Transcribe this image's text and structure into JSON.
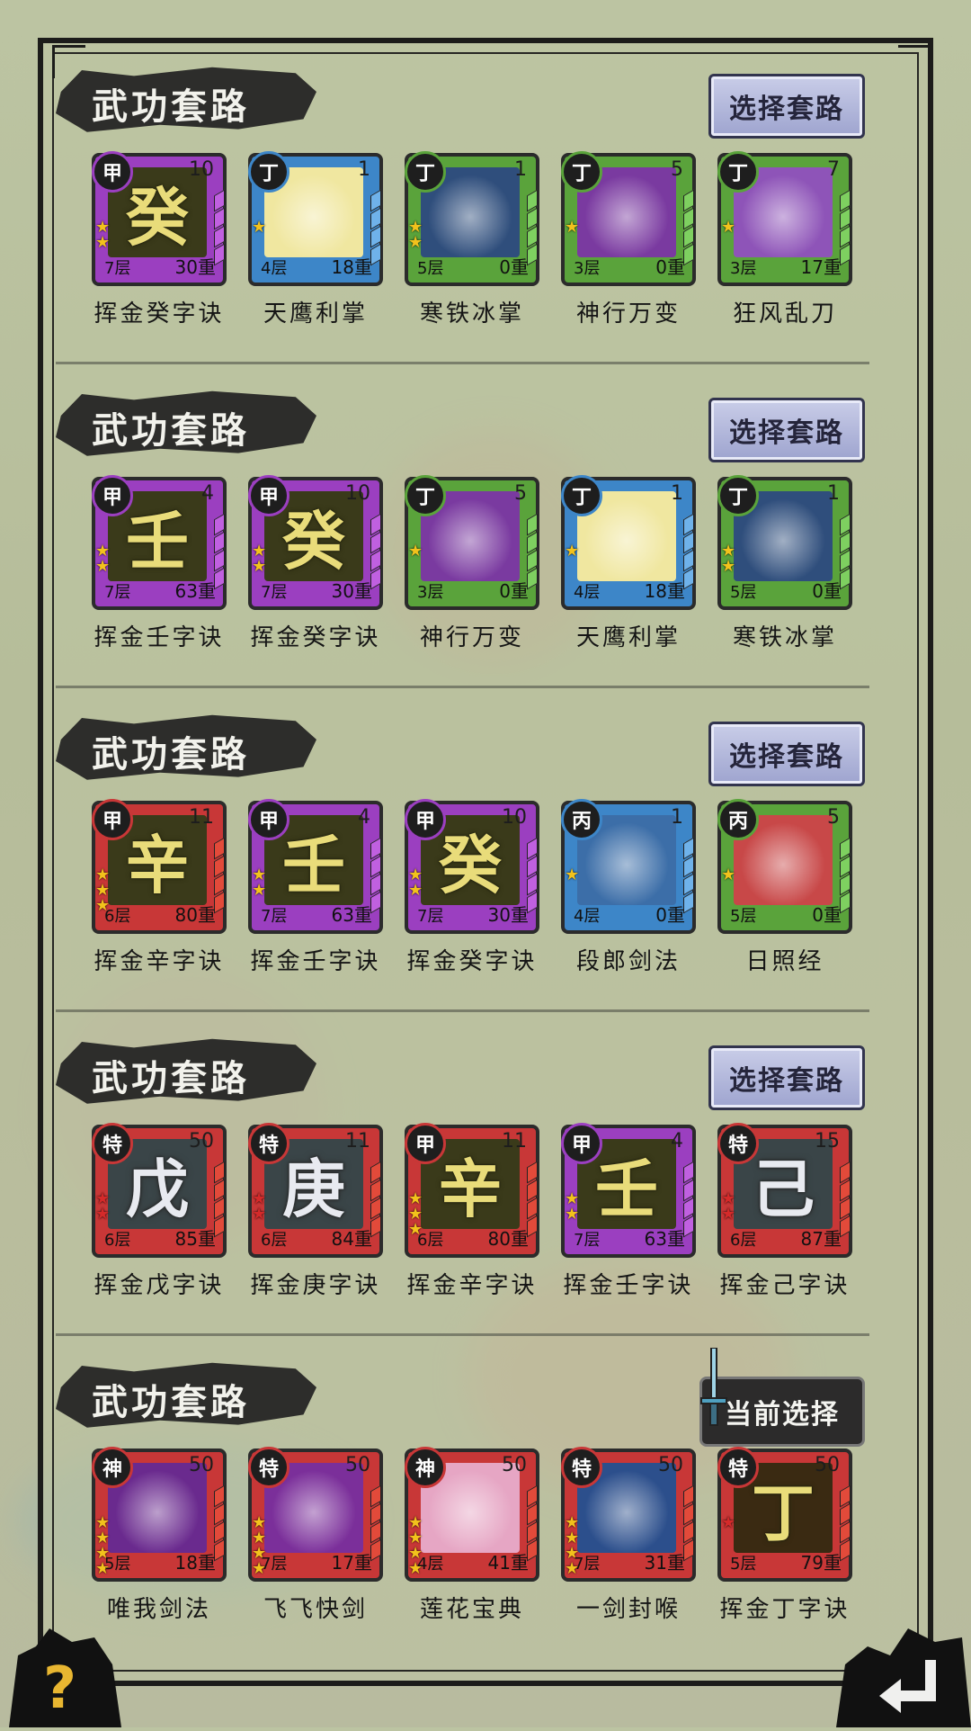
{
  "sections": [
    {
      "title": "武功套路",
      "button": "选择套路",
      "cards": [
        {
          "grade": "甲",
          "level": "10",
          "layer": "7层",
          "weight": "30重",
          "name": "挥金癸字诀",
          "glyph": "癸",
          "frame": "#9b3fc0",
          "art": "#3a3a1a",
          "stars": 2,
          "star_color": "gold"
        },
        {
          "grade": "丁",
          "level": "1",
          "layer": "4层",
          "weight": "18重",
          "name": "天鹰利掌",
          "glyph": "",
          "frame": "#3d86c8",
          "art": "#f0e7a0",
          "stars": 1,
          "star_color": "gold"
        },
        {
          "grade": "丁",
          "level": "1",
          "layer": "5层",
          "weight": "0重",
          "name": "寒铁冰掌",
          "glyph": "",
          "frame": "#5aa33b",
          "art": "#2f4e7c",
          "stars": 2,
          "star_color": "gold"
        },
        {
          "grade": "丁",
          "level": "5",
          "layer": "3层",
          "weight": "0重",
          "name": "神行万变",
          "glyph": "",
          "frame": "#5aa33b",
          "art": "#7a3aa0",
          "stars": 1,
          "star_color": "gold"
        },
        {
          "grade": "丁",
          "level": "7",
          "layer": "3层",
          "weight": "17重",
          "name": "狂风乱刀",
          "glyph": "",
          "frame": "#5aa33b",
          "art": "#8e54b8",
          "stars": 1,
          "star_color": "gold"
        }
      ]
    },
    {
      "title": "武功套路",
      "button": "选择套路",
      "cards": [
        {
          "grade": "甲",
          "level": "4",
          "layer": "7层",
          "weight": "63重",
          "name": "挥金壬字诀",
          "glyph": "壬",
          "frame": "#9b3fc0",
          "art": "#3a3a1a",
          "stars": 2,
          "star_color": "gold"
        },
        {
          "grade": "甲",
          "level": "10",
          "layer": "7层",
          "weight": "30重",
          "name": "挥金癸字诀",
          "glyph": "癸",
          "frame": "#9b3fc0",
          "art": "#3a3a1a",
          "stars": 2,
          "star_color": "gold"
        },
        {
          "grade": "丁",
          "level": "5",
          "layer": "3层",
          "weight": "0重",
          "name": "神行万变",
          "glyph": "",
          "frame": "#5aa33b",
          "art": "#7a3aa0",
          "stars": 1,
          "star_color": "gold"
        },
        {
          "grade": "丁",
          "level": "1",
          "layer": "4层",
          "weight": "18重",
          "name": "天鹰利掌",
          "glyph": "",
          "frame": "#3d86c8",
          "art": "#f0e7a0",
          "stars": 1,
          "star_color": "gold"
        },
        {
          "grade": "丁",
          "level": "1",
          "layer": "5层",
          "weight": "0重",
          "name": "寒铁冰掌",
          "glyph": "",
          "frame": "#5aa33b",
          "art": "#2f4e7c",
          "stars": 2,
          "star_color": "gold"
        }
      ]
    },
    {
      "title": "武功套路",
      "button": "选择套路",
      "cards": [
        {
          "grade": "甲",
          "level": "11",
          "layer": "6层",
          "weight": "80重",
          "name": "挥金辛字诀",
          "glyph": "辛",
          "frame": "#c83737",
          "art": "#3a3a1a",
          "stars": 3,
          "star_color": "gold"
        },
        {
          "grade": "甲",
          "level": "4",
          "layer": "7层",
          "weight": "63重",
          "name": "挥金壬字诀",
          "glyph": "壬",
          "frame": "#9b3fc0",
          "art": "#3a3a1a",
          "stars": 2,
          "star_color": "gold"
        },
        {
          "grade": "甲",
          "level": "10",
          "layer": "7层",
          "weight": "30重",
          "name": "挥金癸字诀",
          "glyph": "癸",
          "frame": "#9b3fc0",
          "art": "#3a3a1a",
          "stars": 2,
          "star_color": "gold"
        },
        {
          "grade": "丙",
          "level": "1",
          "layer": "4层",
          "weight": "0重",
          "name": "段郎剑法",
          "glyph": "",
          "frame": "#3d86c8",
          "art": "#3c6ea8",
          "stars": 1,
          "star_color": "gold"
        },
        {
          "grade": "丙",
          "level": "5",
          "layer": "5层",
          "weight": "0重",
          "name": "日照经",
          "glyph": "",
          "frame": "#5aa33b",
          "art": "#c84848",
          "stars": 1,
          "star_color": "gold"
        }
      ]
    },
    {
      "title": "武功套路",
      "button": "选择套路",
      "cards": [
        {
          "grade": "特",
          "level": "50",
          "layer": "6层",
          "weight": "85重",
          "name": "挥金戊字诀",
          "glyph": "戊",
          "frame": "#c83737",
          "art": "#3a4548",
          "stars": 2,
          "star_color": "red",
          "silver": true
        },
        {
          "grade": "特",
          "level": "11",
          "layer": "6层",
          "weight": "84重",
          "name": "挥金庚字诀",
          "glyph": "庚",
          "frame": "#c83737",
          "art": "#3a4548",
          "stars": 2,
          "star_color": "red",
          "silver": true
        },
        {
          "grade": "甲",
          "level": "11",
          "layer": "6层",
          "weight": "80重",
          "name": "挥金辛字诀",
          "glyph": "辛",
          "frame": "#c83737",
          "art": "#3a3a1a",
          "stars": 3,
          "star_color": "gold"
        },
        {
          "grade": "甲",
          "level": "4",
          "layer": "7层",
          "weight": "63重",
          "name": "挥金壬字诀",
          "glyph": "壬",
          "frame": "#9b3fc0",
          "art": "#3a3a1a",
          "stars": 2,
          "star_color": "gold"
        },
        {
          "grade": "特",
          "level": "15",
          "layer": "6层",
          "weight": "87重",
          "name": "挥金己字诀",
          "glyph": "己",
          "frame": "#c83737",
          "art": "#3a4548",
          "stars": 2,
          "star_color": "red",
          "silver": true
        }
      ]
    },
    {
      "title": "武功套路",
      "button": "当前选择",
      "current": true,
      "cards": [
        {
          "grade": "神",
          "level": "50",
          "layer": "5层",
          "weight": "18重",
          "name": "唯我剑法",
          "glyph": "",
          "frame": "#c83737",
          "art": "#6a2a8e",
          "stars": 4,
          "star_color": "gold"
        },
        {
          "grade": "特",
          "level": "50",
          "layer": "7层",
          "weight": "17重",
          "name": "飞飞快剑",
          "glyph": "",
          "frame": "#c83737",
          "art": "#7b2f9a",
          "stars": 4,
          "star_color": "gold"
        },
        {
          "grade": "神",
          "level": "50",
          "layer": "4层",
          "weight": "41重",
          "name": "莲花宝典",
          "glyph": "",
          "frame": "#c83737",
          "art": "#e6a6c4",
          "stars": 4,
          "star_color": "gold"
        },
        {
          "grade": "特",
          "level": "50",
          "layer": "7层",
          "weight": "31重",
          "name": "一剑封喉",
          "glyph": "",
          "frame": "#c83737",
          "art": "#2c4f8c",
          "stars": 4,
          "star_color": "gold"
        },
        {
          "grade": "特",
          "level": "50",
          "layer": "5层",
          "weight": "79重",
          "name": "挥金丁字诀",
          "glyph": "丁",
          "frame": "#c83737",
          "art": "#3a2a12",
          "stars": 1,
          "star_color": "red"
        }
      ]
    }
  ],
  "help_icon": "question-icon",
  "back_icon": "return-arrow-icon"
}
